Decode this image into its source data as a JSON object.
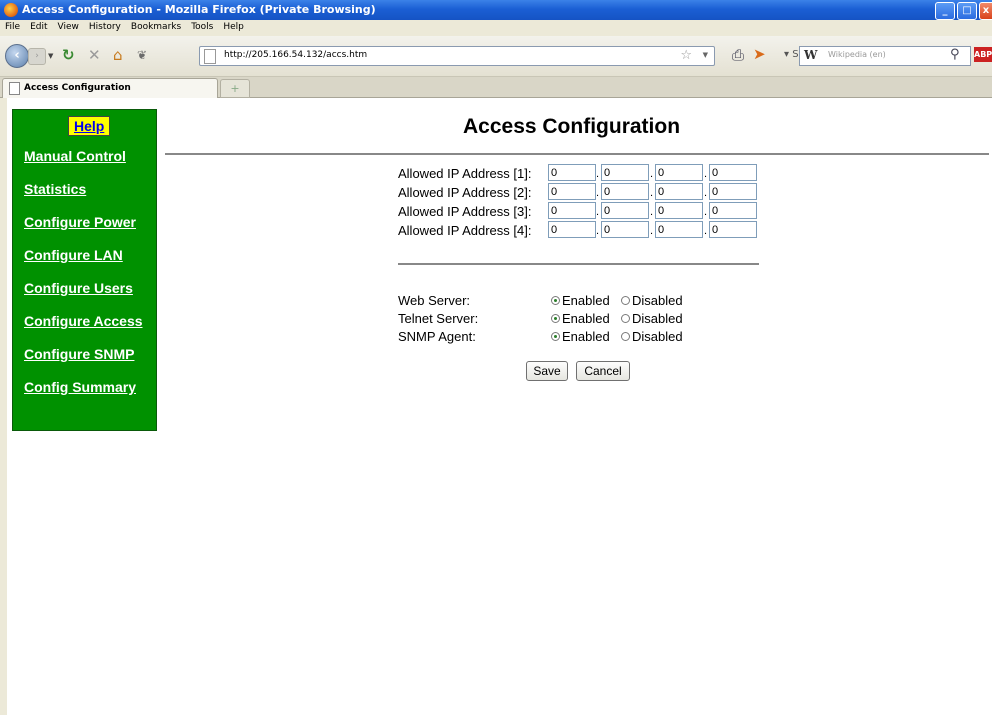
{
  "window": {
    "title": "Access Configuration - Mozilla Firefox (Private Browsing)",
    "buttons": {
      "minimize": "_",
      "maximize": "□",
      "close": "x"
    }
  },
  "menu": {
    "items": [
      "File",
      "Edit",
      "View",
      "History",
      "Bookmarks",
      "Tools",
      "Help"
    ]
  },
  "toolbar": {
    "url": "http://205.166.54.132/accs.htm",
    "search_engine_glyph": "W",
    "search_placeholder": "Wikipedia (en)",
    "abp_label": "ABP",
    "icons": [
      "back-icon",
      "forward-icon",
      "reload-icon",
      "stop-icon",
      "home-icon",
      "greasemonkey-icon",
      "bookmark-star-icon",
      "print-icon",
      "bird-icon",
      "search-icon"
    ]
  },
  "tabs": [
    {
      "label": "Access Configuration"
    }
  ],
  "sidebar": {
    "help": "Help",
    "links": [
      "Manual Control",
      "Statistics",
      "Configure Power",
      "Configure LAN",
      "Configure Users",
      "Configure Access",
      "Configure SNMP",
      "Config Summary"
    ]
  },
  "page": {
    "title": "Access Configuration",
    "ip_rows": [
      {
        "label": "Allowed IP Address [1]:",
        "octets": [
          "0",
          "0",
          "0",
          "0"
        ]
      },
      {
        "label": "Allowed IP Address [2]:",
        "octets": [
          "0",
          "0",
          "0",
          "0"
        ]
      },
      {
        "label": "Allowed IP Address [3]:",
        "octets": [
          "0",
          "0",
          "0",
          "0"
        ]
      },
      {
        "label": "Allowed IP Address [4]:",
        "octets": [
          "0",
          "0",
          "0",
          "0"
        ]
      }
    ],
    "separator": ".",
    "services": [
      {
        "label": "Web Server:",
        "enabled_label": "Enabled",
        "disabled_label": "Disabled",
        "value": "Enabled"
      },
      {
        "label": "Telnet Server:",
        "enabled_label": "Enabled",
        "disabled_label": "Disabled",
        "value": "Enabled"
      },
      {
        "label": "SNMP Agent:",
        "enabled_label": "Enabled",
        "disabled_label": "Disabled",
        "value": "Enabled"
      }
    ],
    "save_label": "Save",
    "cancel_label": "Cancel"
  },
  "colors": {
    "sidebar_bg": "#009100",
    "help_bg": "#ffff00",
    "titlebar": "#1b5fd4"
  }
}
